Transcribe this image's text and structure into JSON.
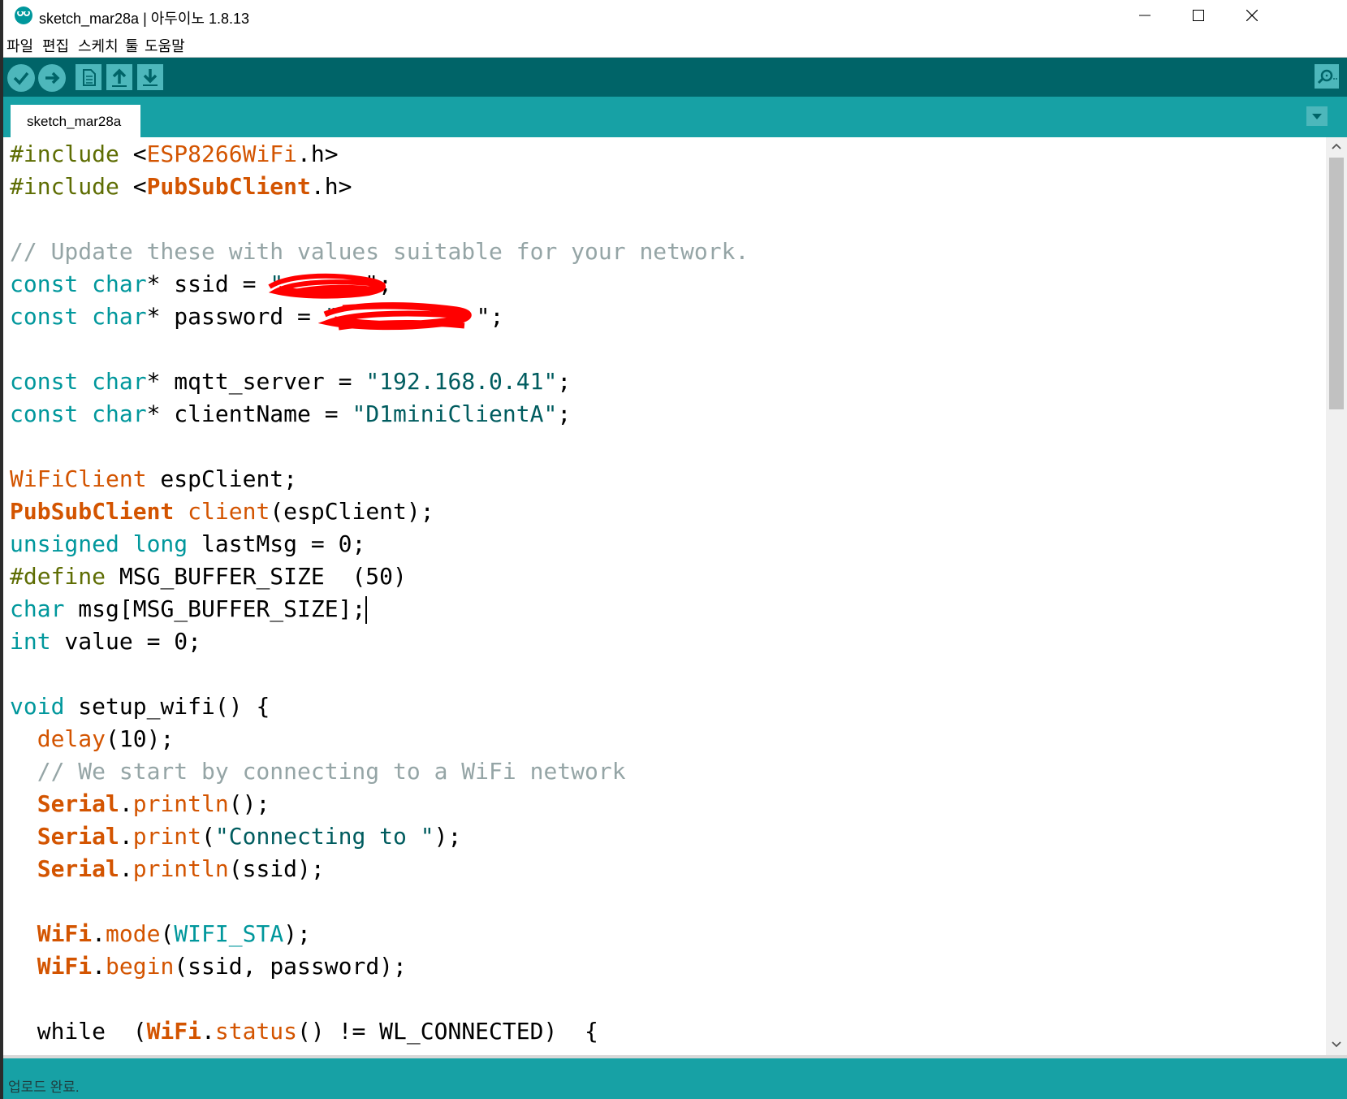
{
  "window": {
    "title": "sketch_mar28a | 아두이노 1.8.13",
    "controls": [
      "minimize",
      "maximize",
      "close"
    ]
  },
  "menu": {
    "items": [
      "파일",
      "편집",
      "스케치",
      "툴",
      "도움말"
    ]
  },
  "toolbar": {
    "buttons": [
      "verify",
      "upload",
      "new",
      "open",
      "save"
    ],
    "right_button": "serial-monitor"
  },
  "tabs": [
    {
      "label": "sketch_mar28a",
      "active": true
    }
  ],
  "colors": {
    "toolbar": "#006468",
    "tabbar": "#17a1a5",
    "button": "#4db7bb",
    "keyword": "#00979c",
    "preprocessor": "#5e6d03",
    "comment": "#95a5a6",
    "type": "#d35400"
  },
  "code": {
    "lines": [
      [
        "#include",
        " <",
        "ESP8266WiFi",
        ".h>"
      ],
      [
        "#include",
        " <",
        "PubSubClient",
        ".h>"
      ],
      [
        ""
      ],
      [
        "// Update these with values suitable for your network."
      ],
      [
        "const",
        " ",
        "char",
        "* ssid = ",
        "\"",
        "\";"
      ],
      [
        "const",
        " ",
        "char",
        "* password = ",
        "\"",
        "\";"
      ],
      [
        ""
      ],
      [
        "const",
        " ",
        "char",
        "* mqtt_server = ",
        "\"192.168.0.41\"",
        ";"
      ],
      [
        "const",
        " ",
        "char",
        "* clientName = ",
        "\"D1miniClientA\"",
        ";"
      ],
      [
        ""
      ],
      [
        "WiFiClient",
        " espClient;"
      ],
      [
        "PubSubClient",
        " ",
        "client",
        "(espClient);"
      ],
      [
        "unsigned",
        " ",
        "long",
        " lastMsg = 0;"
      ],
      [
        "#define",
        " MSG_BUFFER_SIZE  (50)"
      ],
      [
        "char",
        " msg[MSG_BUFFER_SIZE];"
      ],
      [
        "int",
        " value = 0;"
      ],
      [
        ""
      ],
      [
        "void",
        " setup_wifi() {"
      ],
      [
        "  ",
        "delay",
        "(10);"
      ],
      [
        "  // We start by connecting to a WiFi network"
      ],
      [
        "  ",
        "Serial",
        ".",
        "println",
        "();"
      ],
      [
        "  ",
        "Serial",
        ".",
        "print",
        "(",
        "\"Connecting to \"",
        ");"
      ],
      [
        "  ",
        "Serial",
        ".",
        "println",
        "(ssid);"
      ],
      [
        ""
      ],
      [
        "  ",
        "WiFi",
        ".",
        "mode",
        "(",
        "WIFI_STA",
        ");"
      ],
      [
        "  ",
        "WiFi",
        ".",
        "begin",
        "(ssid, password);"
      ],
      [
        ""
      ],
      [
        "  while  (",
        "WiFi",
        ".",
        "status",
        "() != WL_CONNECTED)  {"
      ]
    ]
  },
  "status": {
    "message": "업로드 완료."
  }
}
